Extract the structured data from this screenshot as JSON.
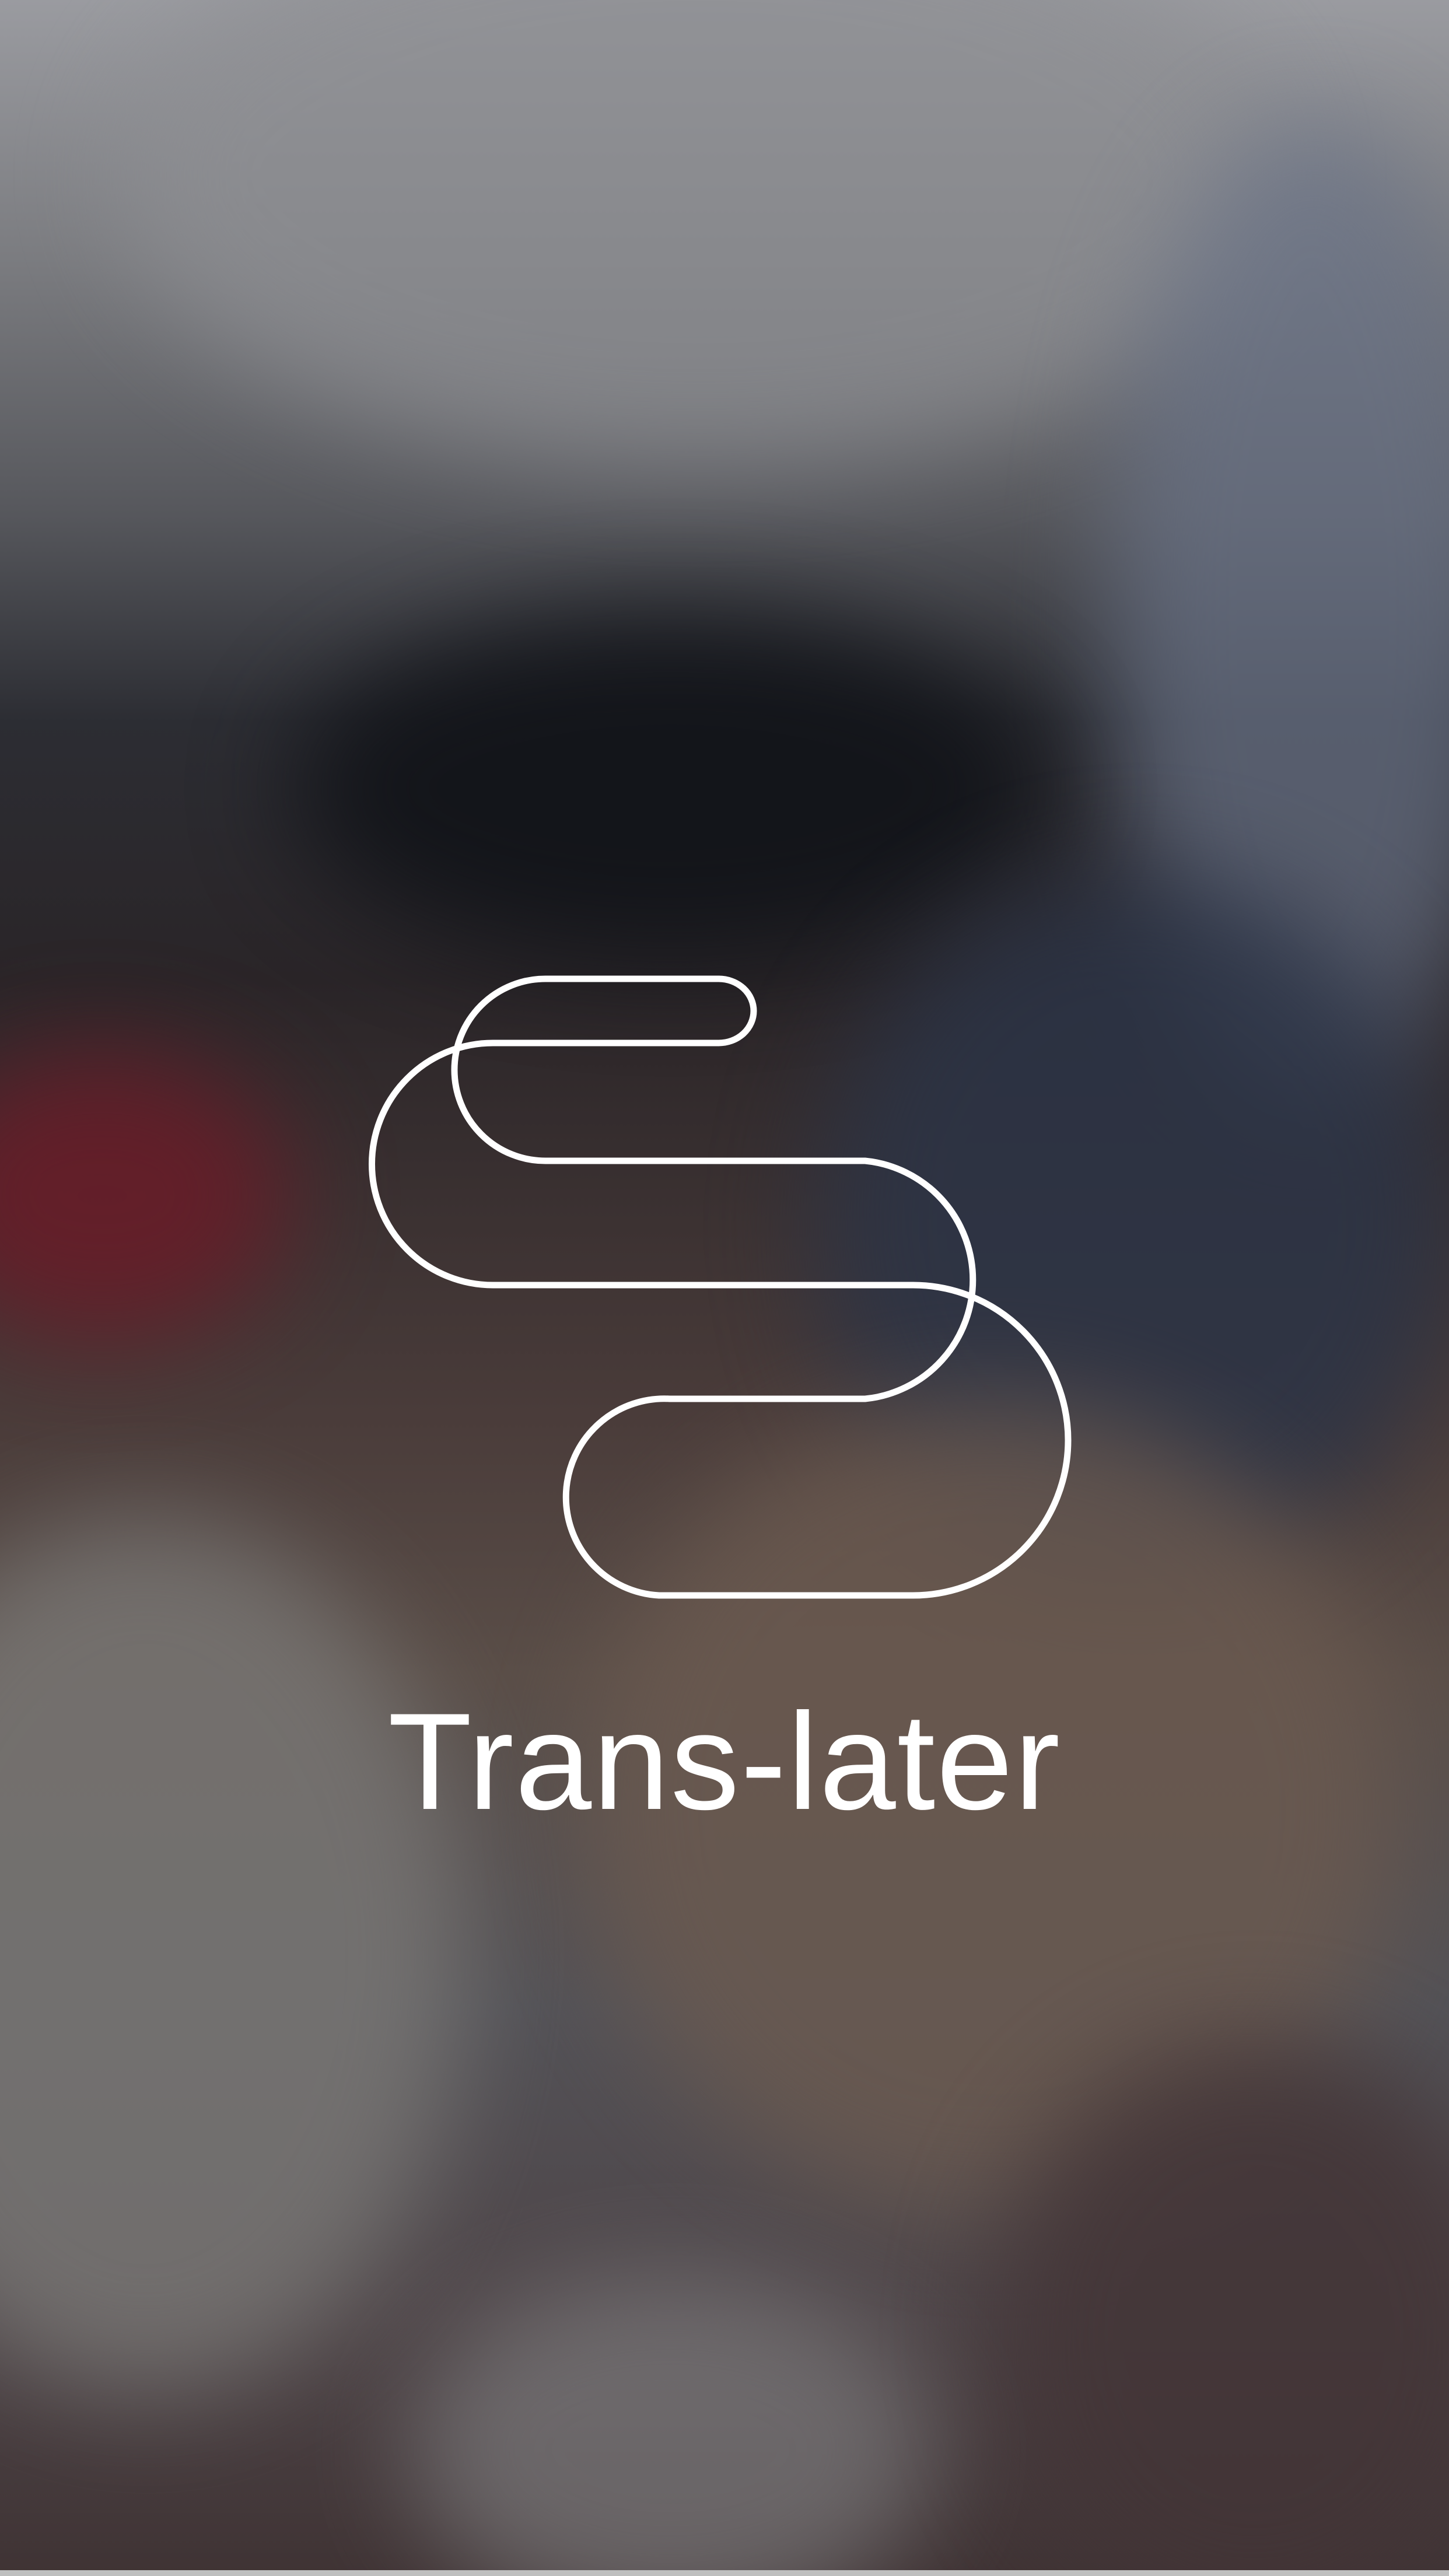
{
  "splash": {
    "app_name": "Trans-later",
    "logo_icon": "app-logo-icon",
    "logo_color": "#ffffff",
    "background": "blurred-photo"
  }
}
